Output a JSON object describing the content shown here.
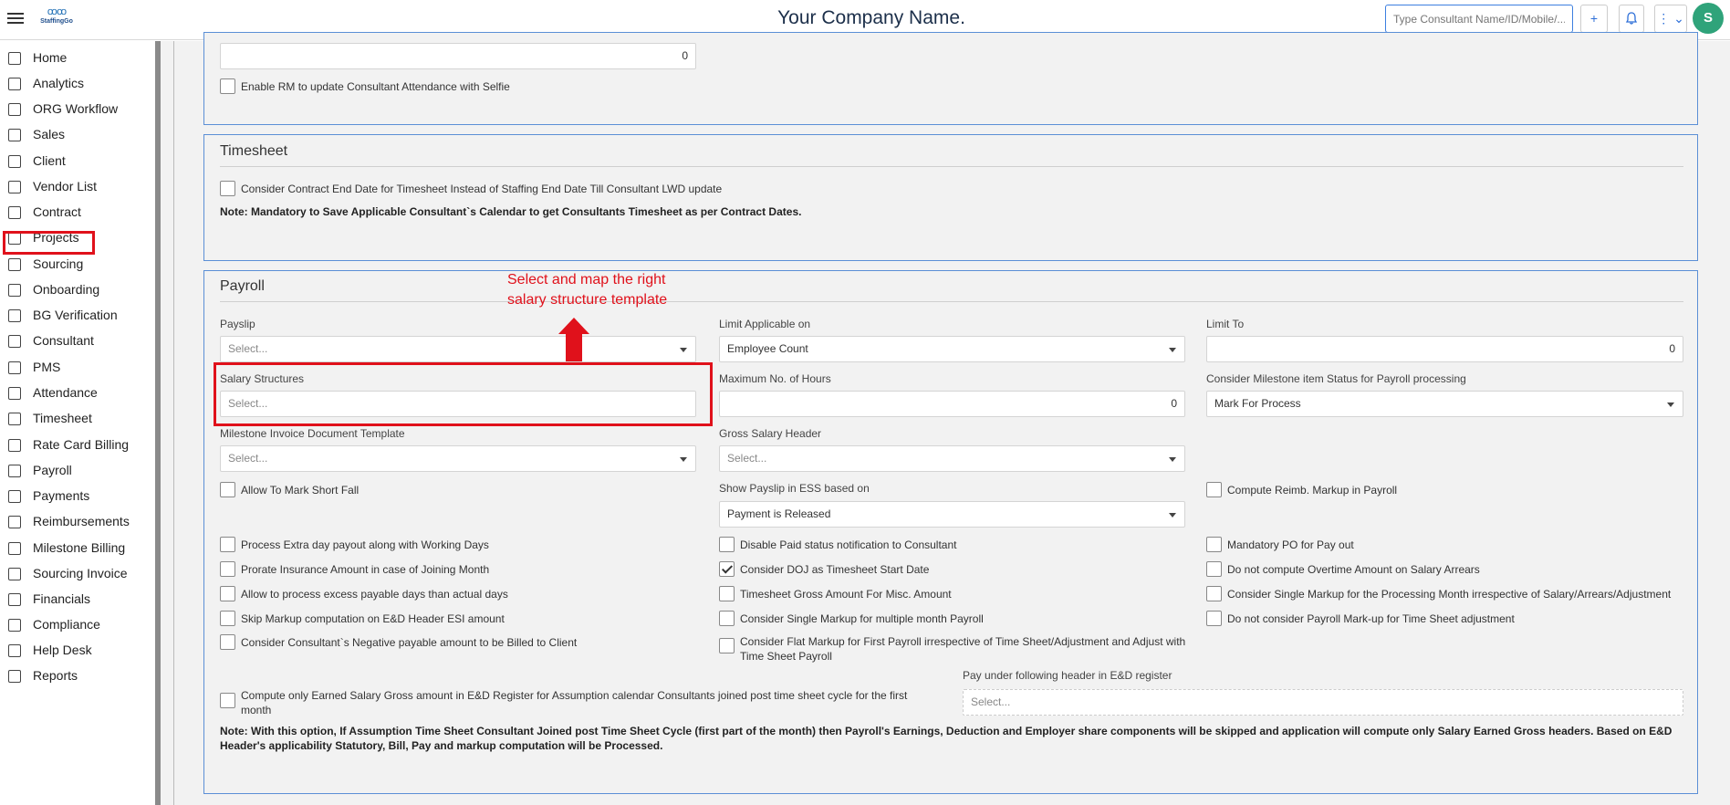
{
  "header": {
    "logo_text": "StaffingGo",
    "company_name": "Your Company Name.",
    "search_placeholder": "Type Consultant Name/ID/Mobile/...",
    "add_symbol": "+",
    "avatar_initial": "S"
  },
  "sidebar": {
    "items": [
      {
        "label": "Home",
        "icon": "home-icon"
      },
      {
        "label": "Analytics",
        "icon": "analytics-icon"
      },
      {
        "label": "ORG Workflow",
        "icon": "workflow-icon"
      },
      {
        "label": "Sales",
        "icon": "sales-icon"
      },
      {
        "label": "Client",
        "icon": "client-icon"
      },
      {
        "label": "Vendor List",
        "icon": "vendor-icon"
      },
      {
        "label": "Contract",
        "icon": "contract-icon"
      },
      {
        "label": "Projects",
        "icon": "projects-icon"
      },
      {
        "label": "Sourcing",
        "icon": "sourcing-icon"
      },
      {
        "label": "Onboarding",
        "icon": "onboarding-icon"
      },
      {
        "label": "BG Verification",
        "icon": "verification-icon"
      },
      {
        "label": "Consultant",
        "icon": "consultant-icon"
      },
      {
        "label": "PMS",
        "icon": "pms-icon"
      },
      {
        "label": "Attendance",
        "icon": "attendance-icon"
      },
      {
        "label": "Timesheet",
        "icon": "timesheet-icon"
      },
      {
        "label": "Rate Card Billing",
        "icon": "rate-card-icon"
      },
      {
        "label": "Payroll",
        "icon": "payroll-icon"
      },
      {
        "label": "Payments",
        "icon": "rupee-icon"
      },
      {
        "label": "Reimbursements",
        "icon": "reimbursements-icon"
      },
      {
        "label": "Milestone Billing",
        "icon": "milestone-icon"
      },
      {
        "label": "Sourcing Invoice",
        "icon": "invoice-icon"
      },
      {
        "label": "Financials",
        "icon": "financials-icon"
      },
      {
        "label": "Compliance",
        "icon": "compliance-icon"
      },
      {
        "label": "Help Desk",
        "icon": "help-icon"
      },
      {
        "label": "Reports",
        "icon": "reports-icon"
      }
    ]
  },
  "top_panel": {
    "value": "0",
    "checkbox_label": "Enable RM to update Consultant Attendance with Selfie"
  },
  "timesheet": {
    "title": "Timesheet",
    "checkbox_label": "Consider Contract End Date for Timesheet Instead of Staffing End Date Till Consultant LWD update",
    "note": "Note: Mandatory to Save Applicable Consultant`s Calendar to get Consultants Timesheet as per Contract Dates."
  },
  "payroll": {
    "title": "Payroll",
    "payslip": {
      "label": "Payslip",
      "placeholder": "Select..."
    },
    "limit_applicable": {
      "label": "Limit Applicable on",
      "value": "Employee Count"
    },
    "limit_to": {
      "label": "Limit To",
      "value": "0"
    },
    "salary_structures": {
      "label": "Salary Structures",
      "placeholder": "Select..."
    },
    "max_hours": {
      "label": "Maximum No. of Hours",
      "value": "0"
    },
    "milestone_status": {
      "label": "Consider Milestone item Status for Payroll processing",
      "value": "Mark For Process"
    },
    "milestone_template": {
      "label": "Milestone Invoice Document Template",
      "placeholder": "Select..."
    },
    "gross_header": {
      "label": "Gross Salary Header",
      "placeholder": "Select..."
    },
    "allow_short_fall": "Allow To Mark Short Fall",
    "show_payslip": {
      "label": "Show Payslip in ESS based on",
      "value": "Payment is Released"
    },
    "compute_reimb": "Compute Reimb. Markup in Payroll",
    "col1": [
      "Process Extra day payout along with Working Days",
      "Prorate Insurance Amount in case of Joining Month",
      "Allow to process excess payable days than actual days",
      "Skip Markup computation on E&D Header ESI amount",
      "Consider Consultant`s Negative payable amount to be Billed to Client"
    ],
    "col2": [
      "Disable Paid status notification to Consultant",
      "Consider DOJ as Timesheet Start Date",
      "Timesheet Gross Amount For Misc. Amount",
      "Consider Single Markup for multiple month Payroll",
      "Consider Flat Markup for First Payroll irrespective of Time Sheet/Adjustment and Adjust with Time Sheet Payroll"
    ],
    "col3": [
      "Mandatory PO for Pay out",
      "Do not compute Overtime Amount on Salary Arrears",
      "Consider Single Markup for the Processing Month irrespective of Salary/Arrears/Adjustment",
      "Do not consider Payroll Mark-up for Time Sheet adjustment"
    ],
    "compute_earned": "Compute only Earned Salary Gross amount in E&D Register for Assumption calendar Consultants joined post time sheet cycle for the first month",
    "pay_under": {
      "label": "Pay under following header in E&D register",
      "placeholder": "Select..."
    },
    "note": "Note: With this option, If Assumption Time Sheet Consultant Joined post Time Sheet Cycle (first part of the month) then Payroll's Earnings, Deduction and Employer share components will be skipped and application will compute only Salary Earned Gross headers. Based on E&D Header's applicability Statutory, Bill, Pay and markup computation will be Processed."
  },
  "annotation": {
    "line1": "Select and map the right",
    "line2": "salary structure template"
  }
}
